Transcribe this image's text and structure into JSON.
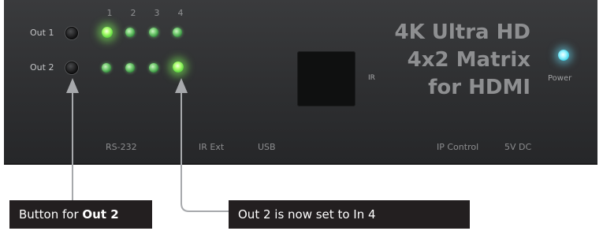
{
  "panel": {
    "column_numbers": [
      "1",
      "2",
      "3",
      "4"
    ],
    "outputs": [
      {
        "label": "Out 1",
        "active_input": 1
      },
      {
        "label": "Out 2",
        "active_input": 4
      }
    ],
    "ir_label": "IR",
    "title_lines": [
      "4K Ultra HD",
      "4x2 Matrix",
      "for HDMI"
    ],
    "power_label": "Power",
    "ports": [
      "RS-232",
      "IR Ext",
      "USB",
      "IP Control",
      "5V DC"
    ]
  },
  "callouts": {
    "button_prefix": "Button for ",
    "button_bold": "Out 2",
    "led_text": "Out 2 is now set to In 4"
  },
  "colors": {
    "panel": "#2e2f31",
    "callout_bg": "#231f20",
    "leader_line": "#a7a9ac",
    "led_green": "#6fe24a",
    "power_led": "#3ed0e6"
  }
}
